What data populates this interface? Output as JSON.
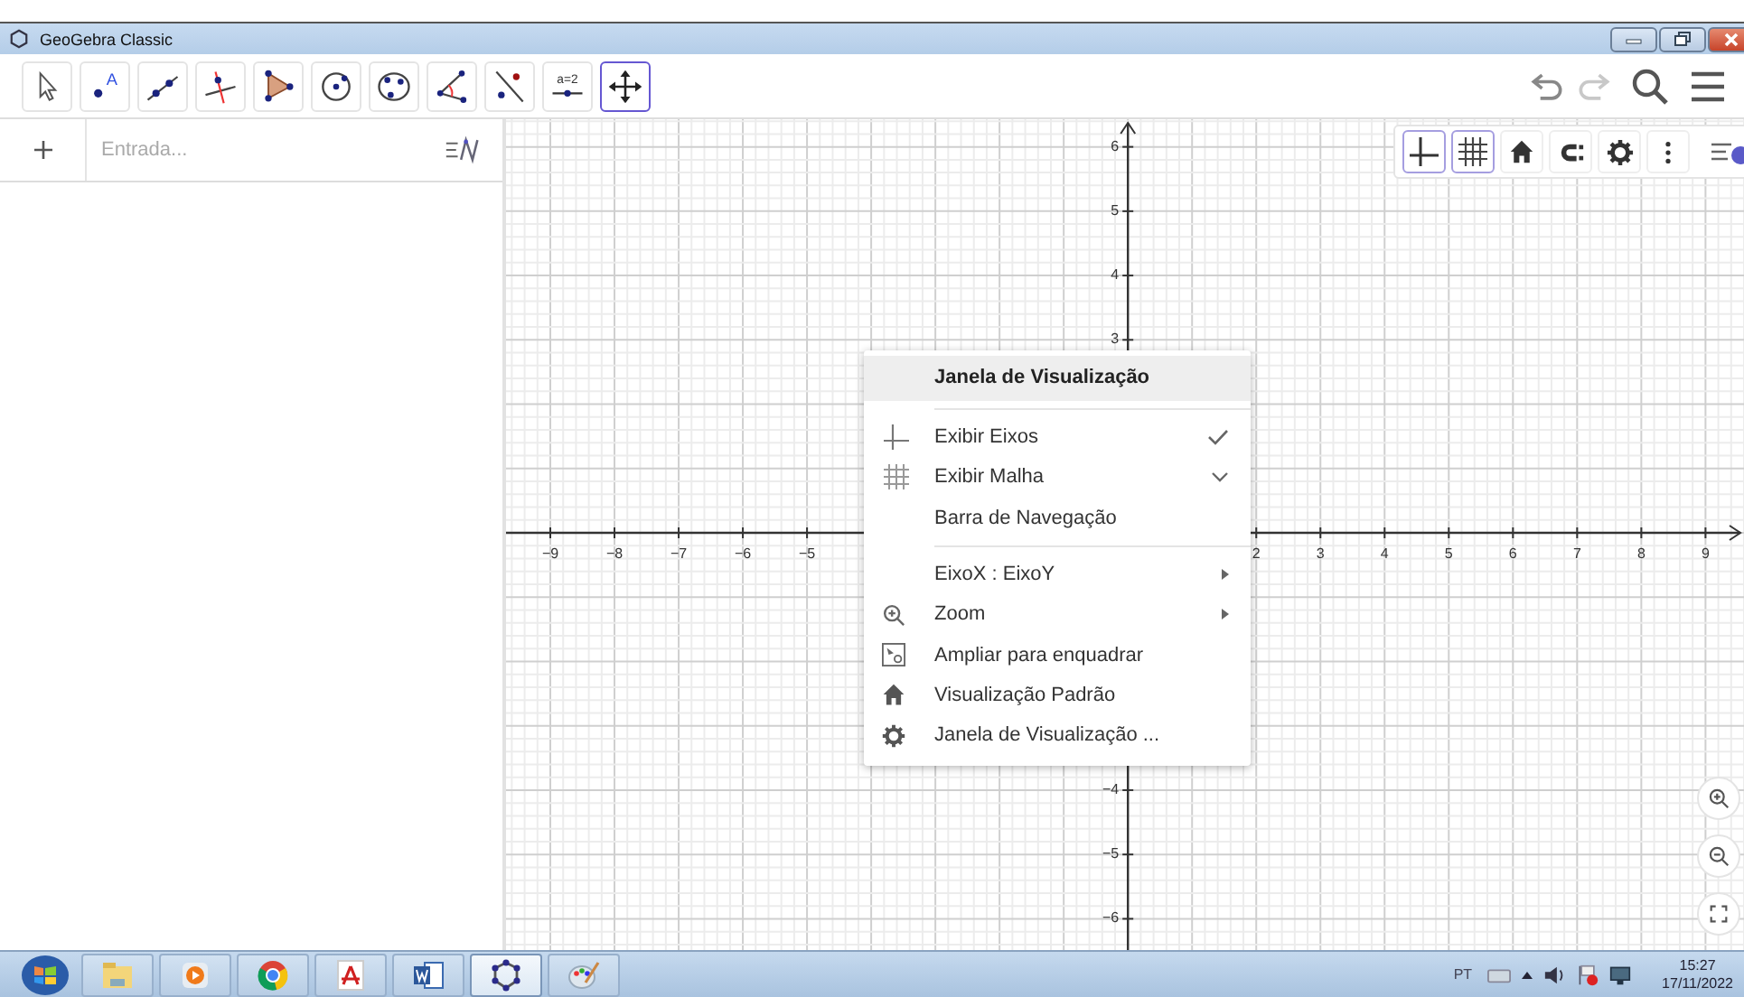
{
  "window": {
    "title": "GeoGebra Classic"
  },
  "toolbar": {
    "tools": [
      {
        "selected": false
      },
      {
        "label": "A",
        "selected": false
      },
      {
        "selected": false
      },
      {
        "selected": false
      },
      {
        "selected": false
      },
      {
        "selected": false
      },
      {
        "selected": false
      },
      {
        "selected": false
      },
      {
        "selected": false
      },
      {
        "label": "a=2",
        "selected": false
      },
      {
        "selected": true
      }
    ],
    "undo": {
      "disabled": false
    },
    "redo": {
      "disabled": true
    }
  },
  "algebra": {
    "input": {
      "placeholder": "Entrada..."
    }
  },
  "style_bar": {
    "toggles": [
      {
        "selected": true
      },
      {
        "selected": true
      }
    ]
  },
  "graphics": {
    "chart_data": {
      "type": "line",
      "grid": true,
      "xlim": [
        -9.69,
        9.6
      ],
      "ylim": [
        -6.57,
        6.43
      ],
      "xticks": [
        {
          "value": -9,
          "label": "−9"
        },
        {
          "value": -8,
          "label": "−8"
        },
        {
          "value": -7,
          "label": "−7"
        },
        {
          "value": -6,
          "label": "−6"
        },
        {
          "value": -5,
          "label": "−5"
        },
        {
          "value": 2,
          "label": "2"
        },
        {
          "value": 3,
          "label": "3"
        },
        {
          "value": 4,
          "label": "4"
        },
        {
          "value": 5,
          "label": "5"
        },
        {
          "value": 6,
          "label": "6"
        },
        {
          "value": 7,
          "label": "7"
        },
        {
          "value": 8,
          "label": "8"
        },
        {
          "value": 9,
          "label": "9"
        }
      ],
      "yticks": [
        {
          "value": 6,
          "label": "6"
        },
        {
          "value": 5,
          "label": "5"
        },
        {
          "value": 4,
          "label": "4"
        },
        {
          "value": 3,
          "label": "3"
        },
        {
          "value": -4,
          "label": "−4"
        },
        {
          "value": -5,
          "label": "−5"
        },
        {
          "value": -6,
          "label": "−6"
        }
      ]
    }
  },
  "context_menu": {
    "title": "Janela de Visualização",
    "items": [
      {
        "kind": "check",
        "label": "Exibir Eixos",
        "checked": true
      },
      {
        "kind": "expand",
        "label": "Exibir Malha"
      },
      {
        "kind": "check",
        "label": "Barra de Navegação",
        "checked": false
      },
      {
        "kind": "separator"
      },
      {
        "kind": "submenu",
        "label": "EixoX : EixoY"
      },
      {
        "kind": "submenu",
        "label": "Zoom"
      },
      {
        "kind": "action",
        "label": "Ampliar para enquadrar"
      },
      {
        "kind": "action",
        "label": "Visualização Padrão"
      },
      {
        "kind": "action",
        "label": "Janela de Visualização ..."
      }
    ]
  },
  "taskbar": {
    "apps": [
      {
        "selected": false
      },
      {
        "selected": false
      },
      {
        "selected": false
      },
      {
        "selected": false
      },
      {
        "selected": false
      },
      {
        "selected": true
      },
      {
        "selected": false
      }
    ],
    "tray": {
      "language": "PT",
      "time": "15:27",
      "date": "17/11/2022"
    }
  }
}
